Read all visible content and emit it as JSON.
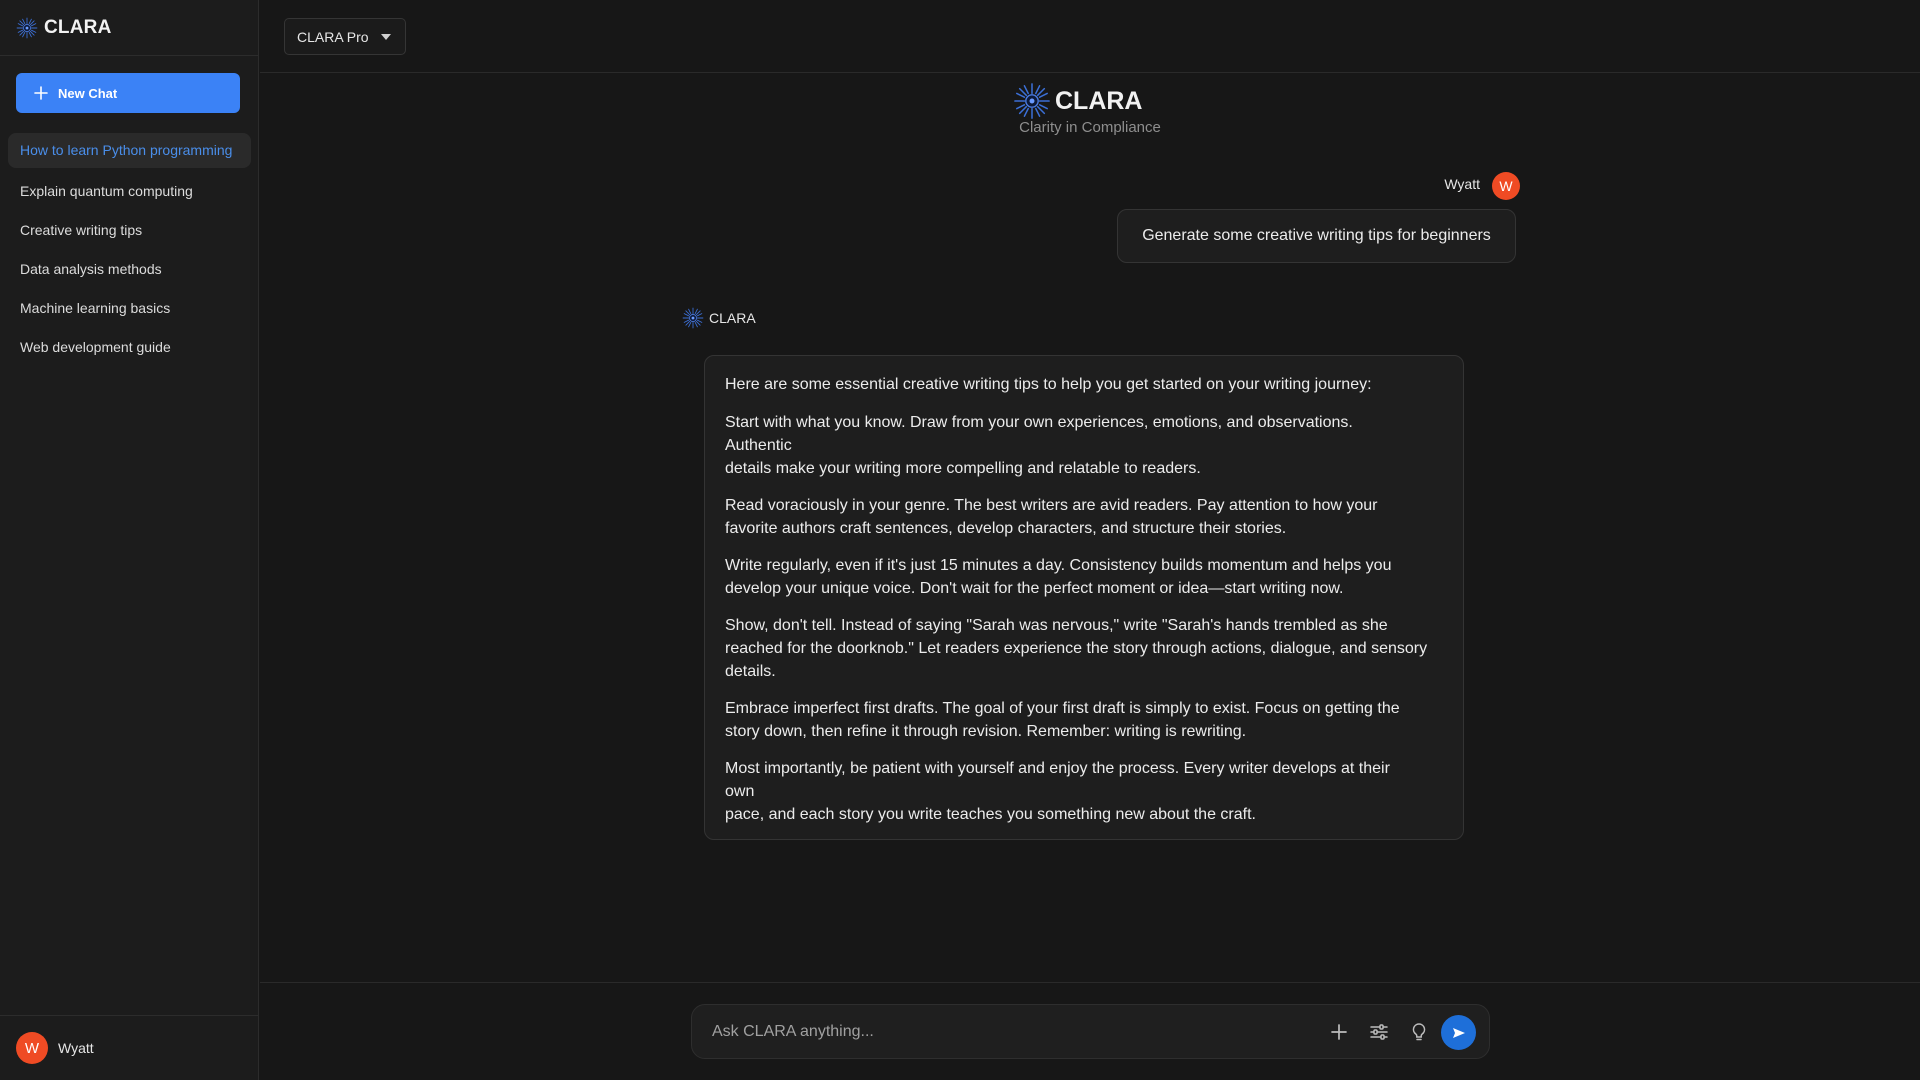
{
  "app": {
    "name": "CLARA",
    "tagline": "Clarity in Compliance"
  },
  "sidebar": {
    "new_chat_label": "New Chat",
    "items": [
      {
        "label": "How to learn Python programming",
        "active": true
      },
      {
        "label": "Explain quantum computing"
      },
      {
        "label": "Creative writing tips"
      },
      {
        "label": "Data analysis methods"
      },
      {
        "label": "Machine learning basics"
      },
      {
        "label": "Web development guide"
      }
    ],
    "user": {
      "initial": "W",
      "name": "Wyatt"
    }
  },
  "topbar": {
    "model": "CLARA Pro"
  },
  "conversation": {
    "user_message": {
      "author": "Wyatt",
      "initial": "W",
      "text": "Generate some creative writing tips for beginners"
    },
    "assistant_message": {
      "author": "CLARA",
      "paragraphs": [
        "Here are some essential creative writing tips to help you get started on your writing journey:",
        "Start with what you know. Draw from your own experiences, emotions, and observations.\nAuthentic\ndetails make your writing more compelling and relatable to readers.",
        "Read voraciously in your genre. The best writers are avid readers. Pay attention to how your\nfavorite authors craft sentences, develop characters, and structure their stories.",
        "Write regularly, even if it's just 15 minutes a day. Consistency builds momentum and helps you\ndevelop your unique voice. Don't wait for the perfect moment or idea—start writing now.",
        "Show, don't tell. Instead of saying \"Sarah was nervous,\" write \"Sarah's hands trembled as she\nreached for the doorknob.\" Let readers experience the story through actions, dialogue, and sensory\ndetails.",
        "Embrace imperfect first drafts. The goal of your first draft is simply to exist. Focus on getting the\nstory down, then refine it through revision. Remember: writing is rewriting.",
        "Most importantly, be patient with yourself and enjoy the process. Every writer develops at their\nown\npace, and each story you write teaches you something new about the craft."
      ]
    }
  },
  "composer": {
    "placeholder": "Ask CLARA anything...",
    "value": "",
    "icons": [
      "plus-icon",
      "sliders-icon",
      "lightbulb-icon",
      "send-icon"
    ]
  },
  "colors": {
    "accent": "#3b82f6",
    "avatar": "#ef4b24",
    "send": "#1e6fd9",
    "active_link": "#4a8eea"
  }
}
